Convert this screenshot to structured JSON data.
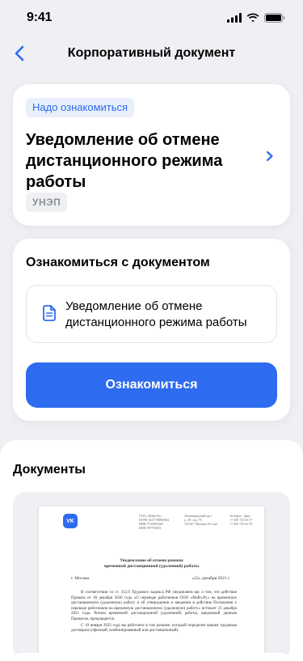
{
  "status_bar": {
    "time": "9:41"
  },
  "nav": {
    "title": "Корпоративный документ"
  },
  "document_card": {
    "badge": "Надо ознакомиться",
    "title": "Уведомление об отмене дистанционного режима работы",
    "signature_type": "УНЭП"
  },
  "acknowledge_card": {
    "title": "Ознакомиться с документом",
    "file_name": "Уведомление об отмене дистанционного режима работы",
    "button_label": "Ознакомиться"
  },
  "documents_section": {
    "title": "Документы",
    "preview": {
      "logo": "VK",
      "company_block": [
        "ООО «Мэйл.Ру»",
        "ОГРН 1027739850962",
        "ИНН 7743001840",
        "КПП 997750001"
      ],
      "address_block": [
        "Ленинградский пр-т",
        "д. 39, стр. 79,",
        "125167, Москва, Россия"
      ],
      "phone_block": [
        "Телефон · факс",
        "+7 495 725 63 57",
        "+7 495 725 63 59"
      ],
      "doc_title_line1": "Уведомление об отмене режима",
      "doc_title_line2": "временной дистанционной (удаленной) работы",
      "city": "г. Москва",
      "date": "«22» декабря 2021 г.",
      "paragraph1": "В соответствии со ст. 312.9 Трудового кодекса РФ уведомляем вас о том, что действие Приказа от 30 декабря 2020 года «О переводе работников ООО «Мэйл.Ру» на временную дистанционную (удаленную) работу и об утверждении и введении в действие Положения о переводе работников на временную дистанционную (удаленную) работу» истекает 31 декабря 2021 года. Режим временной дистанционной (удаленной) работы, введенный данным Приказом, прекращается.",
      "paragraph2": "С 10 января 2022 года вы работаете в том режиме, который определен вашим трудовым договором (офисный, комбинированный или дистанционный)."
    }
  },
  "colors": {
    "accent": "#2D6BEF",
    "background": "#EEF0F3",
    "badge_bg": "#E9EFFB"
  }
}
